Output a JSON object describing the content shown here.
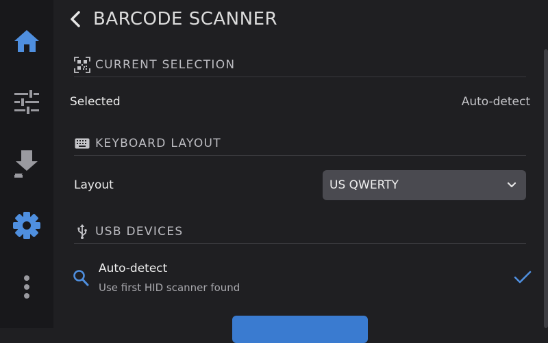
{
  "colors": {
    "accent": "#4f8fdf",
    "background": "#1f1f22",
    "sidebar": "#18181b"
  },
  "sidebar": {
    "items": [
      {
        "icon": "home-icon"
      },
      {
        "icon": "sliders-icon"
      },
      {
        "icon": "download-icon"
      },
      {
        "icon": "gear-icon",
        "active": true
      },
      {
        "icon": "more-vertical-icon"
      }
    ]
  },
  "header": {
    "title": "BARCODE SCANNER",
    "back_icon": "chevron-left-icon"
  },
  "current_selection": {
    "section_title": "CURRENT SELECTION",
    "icon": "qr-code-icon",
    "label": "Selected",
    "value": "Auto-detect"
  },
  "keyboard_layout": {
    "section_title": "KEYBOARD LAYOUT",
    "icon": "keyboard-icon",
    "label": "Layout",
    "selected": "US QWERTY"
  },
  "usb_devices": {
    "section_title": "USB DEVICES",
    "icon": "usb-icon",
    "items": [
      {
        "name": "Auto-detect",
        "description": "Use first HID scanner found",
        "icon": "search-icon",
        "selected": true
      }
    ]
  }
}
